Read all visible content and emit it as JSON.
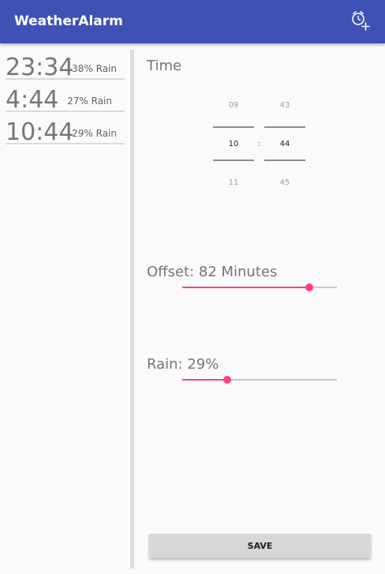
{
  "app": {
    "title": "WeatherAlarm",
    "add_alarm_icon": "alarm-add-icon",
    "colors": {
      "primary": "#3f51b5",
      "accent": "#ff4081"
    }
  },
  "alarms": [
    {
      "time": "23:34",
      "rain": "38% Rain"
    },
    {
      "time": "4:44",
      "rain": "27% Rain"
    },
    {
      "time": "10:44",
      "rain": "29% Rain"
    }
  ],
  "editor": {
    "time_label": "Time",
    "time_picker": {
      "hour_prev": "09",
      "hour": "10",
      "hour_next": "11",
      "separator": ":",
      "minute_prev": "43",
      "minute": "44",
      "minute_next": "45"
    },
    "offset": {
      "label": "Offset: 82 Minutes",
      "fraction": 0.82
    },
    "rain": {
      "label": "Rain: 29%",
      "fraction": 0.29
    },
    "save_label": "SAVE"
  }
}
